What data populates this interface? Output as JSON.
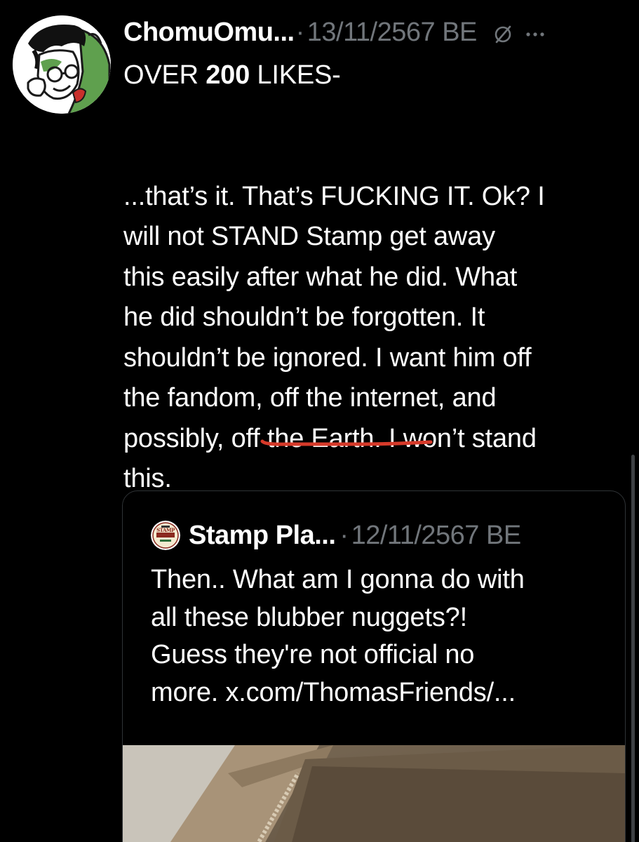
{
  "post": {
    "display_name": "ChomuOmu...",
    "separator": "·",
    "date": "13/11/2567 BE",
    "headline_pre": "OVER ",
    "headline_bold": "200",
    "headline_post": " LIKES-",
    "body_lines": [
      "...that’s it. That’s FUCKING IT. Ok? I",
      "will not STAND Stamp get away",
      "this easily after what he did. What",
      "he did shouldn’t be forgotten. It",
      "shouldn’t be ignored. I want him off",
      "the fandom, off the internet, and",
      "possibly, off the Earth. I won’t stand",
      "this."
    ],
    "icons": {
      "grok": "grok-slash-icon",
      "more": "more-dots-icon"
    }
  },
  "quote": {
    "display_name": "Stamp Pla...",
    "separator": "·",
    "date": "12/11/2567 BE",
    "avatar_logo_text": "STAMP",
    "body_lines": [
      "Then.. What am I gonna do with",
      "all these blubber nuggets?!",
      "Guess they're not official no",
      "more. x.com/ThomasFriends/..."
    ]
  },
  "colors": {
    "background": "#000000",
    "text": "#ffffff",
    "muted": "#71767b",
    "border": "#2f3336",
    "annotation_red": "#d63a2a",
    "avatar_green": "#5fa04e"
  }
}
